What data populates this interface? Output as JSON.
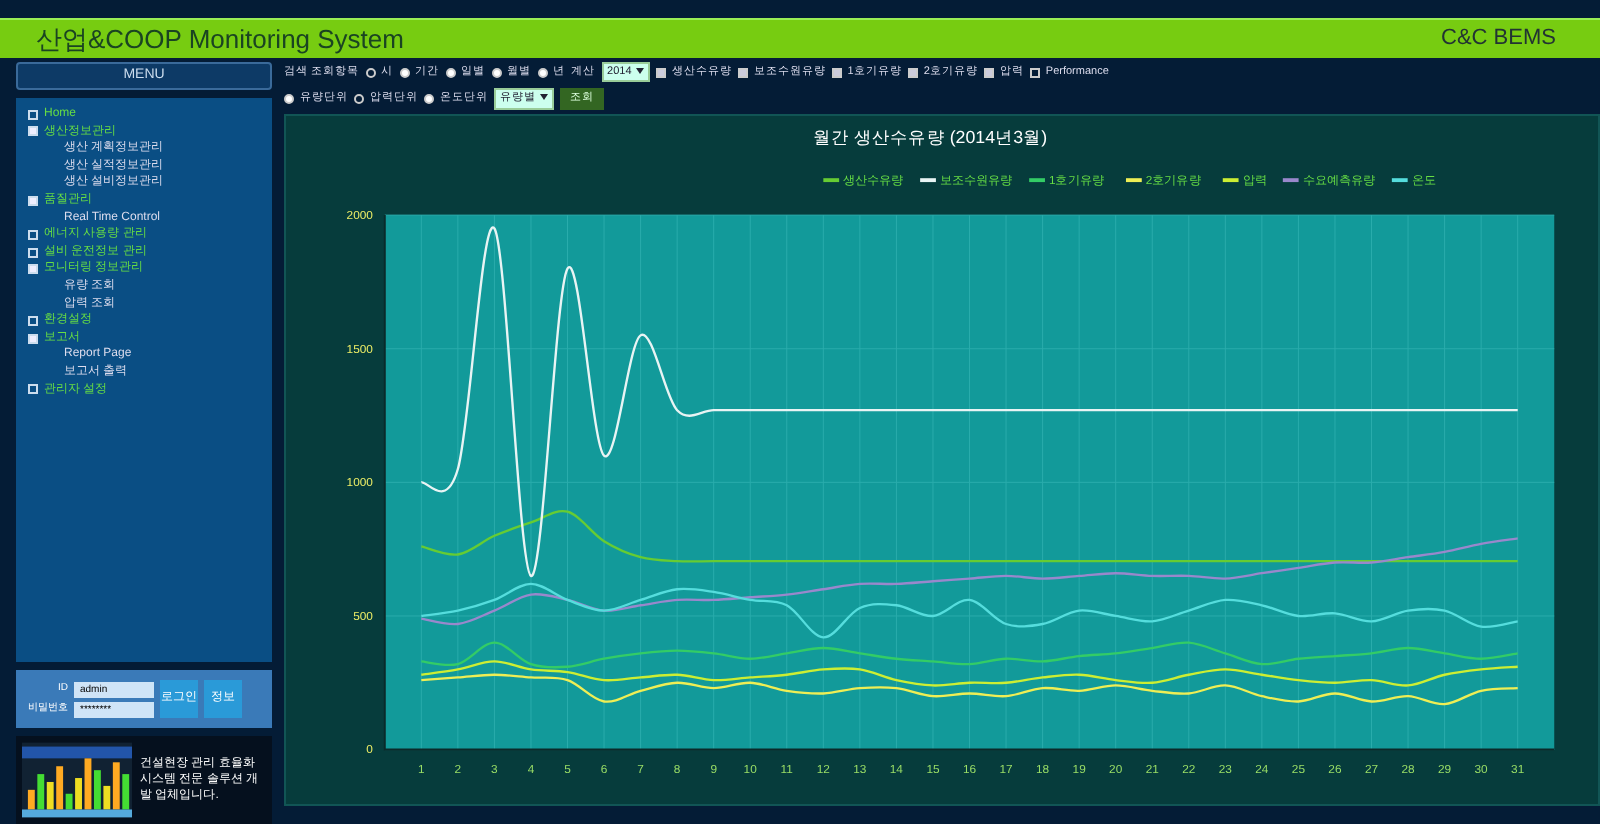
{
  "header": {
    "title": "산업&COOP Monitoring System",
    "brand": "C&C BEMS"
  },
  "sidebar": {
    "menu_button": "MENU",
    "tree": [
      {
        "label": "Home",
        "expanded": false
      },
      {
        "label": "생산정보관리",
        "expanded": true,
        "children": [
          {
            "label": "생산 계획정보관리"
          },
          {
            "label": "생산 실적정보관리"
          },
          {
            "label": "생산 설비정보관리"
          }
        ]
      },
      {
        "label": "품질관리",
        "expanded": true,
        "children": [
          {
            "label": "Real Time Control"
          }
        ]
      },
      {
        "label": "에너지 사용량 관리",
        "expanded": false
      },
      {
        "label": "설비 운전정보 관리",
        "expanded": false
      },
      {
        "label": "모니터링 정보관리",
        "expanded": true,
        "children": [
          {
            "label": "유량 조회"
          },
          {
            "label": "압력 조회"
          }
        ]
      },
      {
        "label": "환경설정",
        "expanded": false
      },
      {
        "label": "보고서",
        "expanded": true,
        "children": [
          {
            "label": "Report Page"
          },
          {
            "label": "보고서 출력"
          }
        ]
      },
      {
        "label": "관리자 설정",
        "expanded": false
      }
    ]
  },
  "login": {
    "fields": [
      {
        "label": "ID",
        "value": "admin"
      },
      {
        "label": "비밀번호",
        "value": "********"
      }
    ],
    "buttons": [
      "로그인",
      "정보"
    ]
  },
  "banner": {
    "text": "건설현장 관리 효율화 시스템 전문 솔루션 개발 업체입니다."
  },
  "toolbar": {
    "rows": [
      {
        "items": [
          {
            "kind": "label",
            "text": "검색 조회항목"
          },
          {
            "kind": "radio",
            "text": "시",
            "selected": false
          },
          {
            "kind": "radio",
            "text": "기간",
            "selected": true
          },
          {
            "kind": "radio",
            "text": "일별",
            "selected": true
          },
          {
            "kind": "radio",
            "text": "월별",
            "selected": true
          },
          {
            "kind": "radio",
            "text": "년",
            "selected": true
          },
          {
            "kind": "label",
            "text": "계산"
          },
          {
            "kind": "select",
            "text": "2014"
          },
          {
            "kind": "checkbox",
            "text": "생산수유량",
            "checked": true
          },
          {
            "kind": "checkbox",
            "text": "보조수원유량",
            "checked": true
          },
          {
            "kind": "checkbox",
            "text": "1호기유량",
            "checked": true
          },
          {
            "kind": "checkbox",
            "text": "2호기유량",
            "checked": true
          },
          {
            "kind": "checkbox",
            "text": "압력",
            "checked": true
          },
          {
            "kind": "checkbox",
            "text": "Performance",
            "checked": false
          }
        ]
      },
      {
        "items": [
          {
            "kind": "radio",
            "text": "유량단위",
            "selected": true
          },
          {
            "kind": "radio",
            "text": "압력단위",
            "selected": false
          },
          {
            "kind": "radio",
            "text": "온도단위",
            "selected": true
          },
          {
            "kind": "select",
            "text": "유량별"
          },
          {
            "kind": "button",
            "text": "조회"
          }
        ]
      }
    ]
  },
  "chart": {
    "chart_data": {
      "type": "line",
      "title": "월간 생산수유량 (2014년3월)",
      "x": [
        1,
        2,
        3,
        4,
        5,
        6,
        7,
        8,
        9,
        10,
        11,
        12,
        13,
        14,
        15,
        16,
        17,
        18,
        19,
        20,
        21,
        22,
        23,
        24,
        25,
        26,
        27,
        28,
        29,
        30,
        31
      ],
      "xlim": [
        0,
        32
      ],
      "ylim": [
        0,
        2000
      ],
      "grid": true,
      "legend": true,
      "yticks": [
        0,
        500,
        1000,
        1500,
        2000
      ],
      "xticks": [
        1,
        2,
        3,
        4,
        5,
        6,
        7,
        8,
        9,
        10,
        11,
        12,
        13,
        14,
        15,
        16,
        17,
        18,
        19,
        20,
        21,
        22,
        23,
        24,
        25,
        26,
        27,
        28,
        29,
        30,
        31
      ],
      "series": [
        {
          "name": "생산수유량",
          "color": "#66cc33",
          "values": [
            760,
            730,
            800,
            850,
            890,
            780,
            720,
            705,
            705,
            705,
            705,
            705,
            705,
            705,
            705,
            705,
            705,
            705,
            705,
            705,
            705,
            705,
            705,
            705,
            705,
            705,
            705,
            705,
            705,
            705,
            705
          ]
        },
        {
          "name": "보조수원유량",
          "color": "#e8f4f4",
          "values": [
            1000,
            1050,
            1950,
            650,
            1800,
            1100,
            1550,
            1270,
            1270,
            1270,
            1270,
            1270,
            1270,
            1270,
            1270,
            1270,
            1270,
            1270,
            1270,
            1270,
            1270,
            1270,
            1270,
            1270,
            1270,
            1270,
            1270,
            1270,
            1270,
            1270,
            1270
          ]
        },
        {
          "name": "1호기유량",
          "color": "#33cc66",
          "values": [
            330,
            320,
            400,
            320,
            310,
            340,
            360,
            370,
            360,
            340,
            360,
            380,
            360,
            340,
            330,
            320,
            340,
            330,
            350,
            360,
            380,
            400,
            360,
            320,
            340,
            350,
            360,
            380,
            360,
            340,
            360
          ]
        },
        {
          "name": "2호기유량",
          "color": "#eeee55",
          "values": [
            260,
            270,
            280,
            270,
            260,
            180,
            220,
            250,
            230,
            250,
            220,
            210,
            230,
            230,
            200,
            210,
            200,
            230,
            220,
            240,
            220,
            210,
            240,
            200,
            180,
            210,
            180,
            200,
            170,
            220,
            230
          ]
        },
        {
          "name": "압력",
          "color": "#ccee33",
          "values": [
            280,
            300,
            330,
            300,
            290,
            260,
            270,
            280,
            260,
            270,
            280,
            300,
            300,
            260,
            240,
            250,
            250,
            270,
            280,
            260,
            250,
            280,
            300,
            280,
            260,
            250,
            260,
            240,
            280,
            300,
            310
          ]
        },
        {
          "name": "수요예측유량",
          "color": "#9988cc",
          "values": [
            490,
            470,
            520,
            580,
            560,
            520,
            540,
            560,
            560,
            570,
            580,
            600,
            620,
            620,
            630,
            640,
            650,
            640,
            650,
            660,
            650,
            650,
            640,
            660,
            680,
            700,
            700,
            720,
            740,
            770,
            790
          ]
        },
        {
          "name": "온도",
          "color": "#55dddd",
          "values": [
            500,
            520,
            560,
            620,
            560,
            520,
            560,
            600,
            590,
            560,
            540,
            420,
            530,
            540,
            500,
            560,
            470,
            470,
            520,
            500,
            480,
            520,
            560,
            540,
            500,
            510,
            480,
            520,
            520,
            460,
            480
          ]
        }
      ]
    }
  }
}
